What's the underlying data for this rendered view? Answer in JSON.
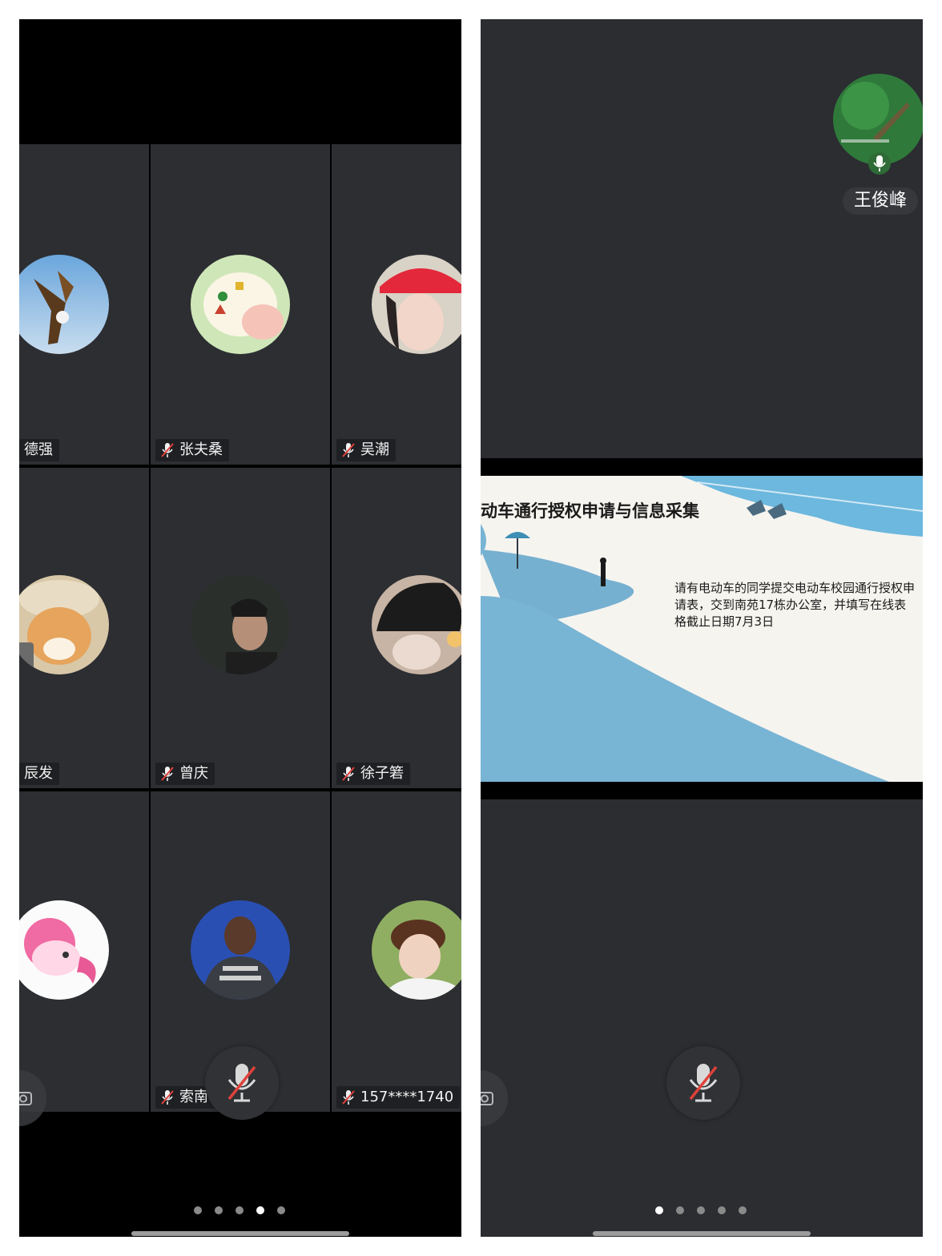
{
  "left_screen": {
    "participants": [
      {
        "name": "德强",
        "muted": false
      },
      {
        "name": "张夫桑",
        "muted": true
      },
      {
        "name": "吴潮",
        "muted": true
      },
      {
        "name": "辰发",
        "muted": false
      },
      {
        "name": "曾庆",
        "muted": true
      },
      {
        "name": "徐子箬",
        "muted": true
      },
      {
        "name": "",
        "muted": false
      },
      {
        "name": "索南",
        "muted": true
      },
      {
        "name": "157****1740",
        "muted": true
      }
    ],
    "page_dots": 5,
    "active_dot": 4
  },
  "right_screen": {
    "speaker_name": "王俊峰",
    "slide": {
      "title": "动车通行授权申请与信息采集",
      "body": "请有电动车的同学提交电动车校园通行授权申请表，交到南苑17栋办公室，并填写在线表格截止日期7月3日"
    },
    "page_dots": 5,
    "active_dot": 1
  },
  "colors": {
    "tile_bg": "#2c2e32",
    "nameplate_bg": "#1f2023",
    "mute_red": "#e0413b",
    "sea_blue": "#7fb3d3"
  }
}
